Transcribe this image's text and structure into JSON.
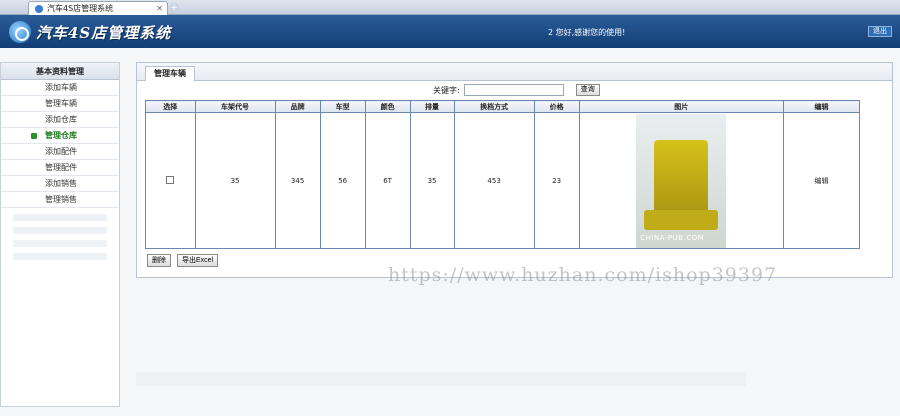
{
  "browser": {
    "tab_title": "汽车4S店管理系统",
    "new_tab": "+"
  },
  "header": {
    "brand": "汽车4S店管理系统",
    "welcome": "2 您好,感谢您的使用!",
    "logout": "退出"
  },
  "sidebar": {
    "title": "基本资料管理",
    "items": [
      {
        "label": "添加车辆"
      },
      {
        "label": "管理车辆"
      },
      {
        "label": "添加仓库"
      },
      {
        "label": "管理仓库",
        "active": true
      },
      {
        "label": "添加配件"
      },
      {
        "label": "管理配件"
      },
      {
        "label": "添加销售"
      },
      {
        "label": "管理销售"
      }
    ]
  },
  "content": {
    "tab": "管理车辆",
    "search": {
      "label": "关键字:",
      "value": "",
      "button": "查询"
    },
    "table": {
      "headers": [
        "选择",
        "车架代号",
        "品牌",
        "车型",
        "颜色",
        "排量",
        "换档方式",
        "价格",
        "图片",
        "编辑"
      ],
      "row": {
        "frame_code": "35",
        "brand": "345",
        "model": "56",
        "color": "6T",
        "displacement": "35",
        "transmission": "453",
        "price": "23",
        "edit": "编辑"
      }
    },
    "image_watermark": "CHINA-PUB.COM",
    "buttons": {
      "delete": "删除",
      "export": "导出Excel"
    }
  },
  "overlay_watermark": "https://www.huzhan.com/ishop39397"
}
